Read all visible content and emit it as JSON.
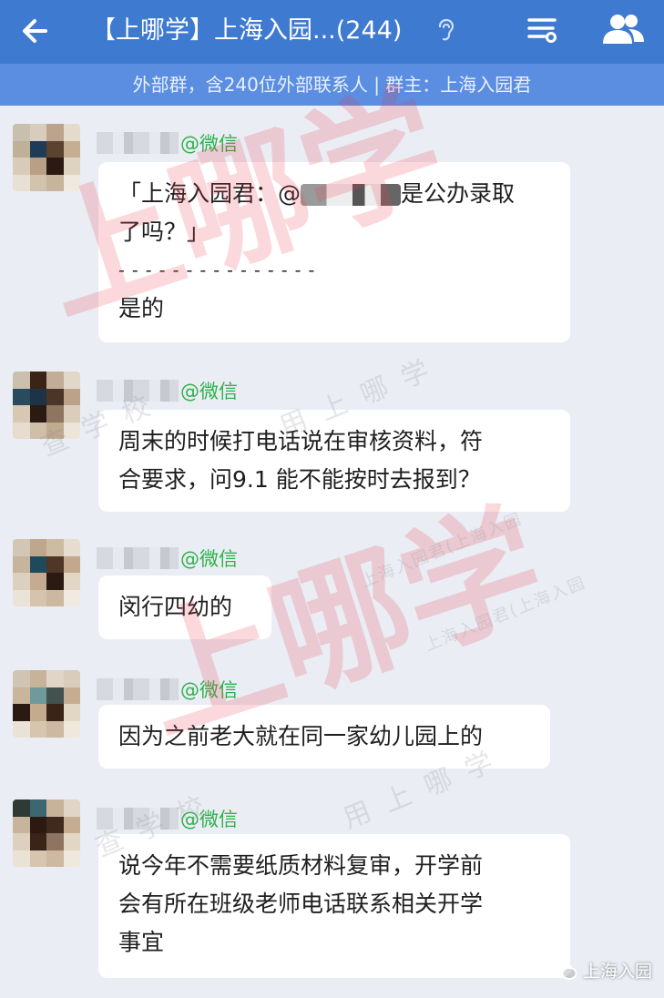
{
  "header": {
    "title": "【上哪学】上海入园...(244)",
    "subtitle": "外部群，含240位外部联系人 | 群主：上海入园君"
  },
  "messages": [
    {
      "tag": "@微信",
      "lines": [
        "「上海入园君：@",
        "是公办录取",
        "了吗？」",
        "- - - - - - - - - - - - - - -",
        "是的"
      ]
    },
    {
      "tag": "@微信",
      "lines": [
        "周末的时候打电话说在审核资料，符",
        "合要求，问9.1 能不能按时去报到？"
      ]
    },
    {
      "tag": "@微信",
      "lines": [
        "闵行四幼的"
      ]
    },
    {
      "tag": "@微信",
      "lines": [
        "因为之前老大就在同一家幼儿园上的"
      ]
    },
    {
      "tag": "@微信",
      "lines": [
        "说今年不需要纸质材料复审，开学前",
        "会有所在班级老师电话联系相关开学",
        "事宜"
      ]
    }
  ],
  "watermarks": {
    "big": "上哪学",
    "small_1": "查学校",
    "small_2": "用上哪学",
    "small_3": "上海入园君(上海入园",
    "brand": "上海入园"
  },
  "colors": {
    "topbar": "#3f7ad1",
    "subbar": "#5b8ee0",
    "wechat_tag": "#2db24a",
    "watermark_red": "#eb3c4b"
  }
}
